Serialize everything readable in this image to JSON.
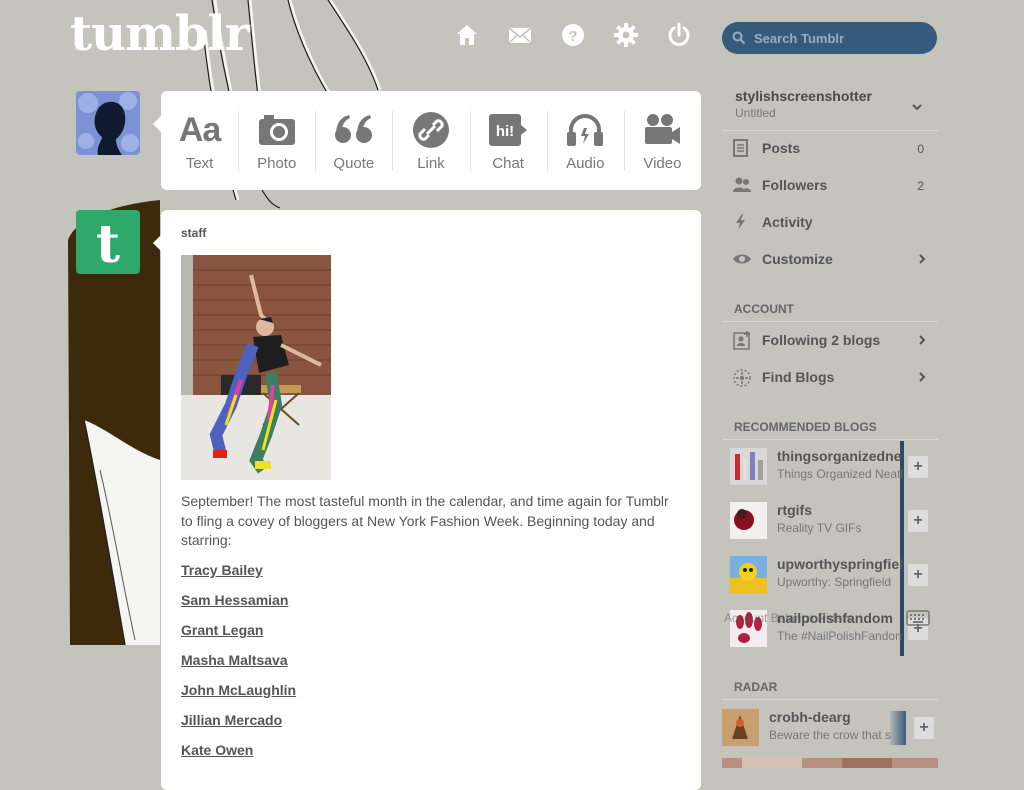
{
  "header": {
    "logo": "tumblr",
    "nav": [
      {
        "name": "home-icon"
      },
      {
        "name": "mail-icon"
      },
      {
        "name": "help-icon"
      },
      {
        "name": "gear-icon"
      },
      {
        "name": "power-icon"
      }
    ],
    "search_placeholder": "Search Tumblr"
  },
  "post_types": [
    {
      "label": "Text",
      "icon": "text-icon"
    },
    {
      "label": "Photo",
      "icon": "camera-icon"
    },
    {
      "label": "Quote",
      "icon": "quote-icon"
    },
    {
      "label": "Link",
      "icon": "link-icon"
    },
    {
      "label": "Chat",
      "icon": "chat-icon"
    },
    {
      "label": "Audio",
      "icon": "headphones-icon"
    },
    {
      "label": "Video",
      "icon": "video-camera-icon"
    }
  ],
  "post": {
    "author": "staff",
    "body": "September! The most tasteful month in the calendar, and time again for Tumblr to fling a covey of bloggers at New York Fashion Week. Beginning today and starring:",
    "links": [
      "Tracy Bailey",
      "Sam Hessamian",
      "Grant Legan",
      "Masha Maltsava",
      "John McLaughlin",
      "Jillian Mercado",
      "Kate Owen"
    ]
  },
  "sidebar": {
    "blog_name": "stylishscreenshotter",
    "blog_subtitle": "Untitled",
    "items": [
      {
        "label": "Posts",
        "count": "0",
        "icon": "posts-icon"
      },
      {
        "label": "Followers",
        "count": "2",
        "icon": "followers-icon"
      },
      {
        "label": "Activity",
        "count": "",
        "icon": "lightning-icon"
      },
      {
        "label": "Customize",
        "count": "",
        "icon": "eye-icon"
      }
    ],
    "account_title": "ACCOUNT",
    "account_items": [
      {
        "label": "Following 2 blogs",
        "icon": "following-icon"
      },
      {
        "label": "Find Blogs",
        "icon": "find-icon"
      }
    ],
    "recommended_title": "RECOMMENDED BLOGS",
    "recommended": [
      {
        "name": "thingsorganizedneatly",
        "desc": "Things Organized Neatly"
      },
      {
        "name": "rtgifs",
        "desc": "Reality TV GIFs"
      },
      {
        "name": "upworthyspringfield",
        "desc": "Upworthy: Springfield"
      },
      {
        "name": "nailpolishfandom",
        "desc": "The #NailPolishFandom"
      }
    ],
    "overlay_text": "Account Balance Riders",
    "radar_title": "RADAR",
    "radar": {
      "name": "crobh-dearg",
      "desc": "Beware the crow that s"
    }
  },
  "colors": {
    "background": "#c4c4bc",
    "search_bg": "#365a7c",
    "staff_avatar": "#2fa86b",
    "link_blue": "#2f4a66"
  }
}
